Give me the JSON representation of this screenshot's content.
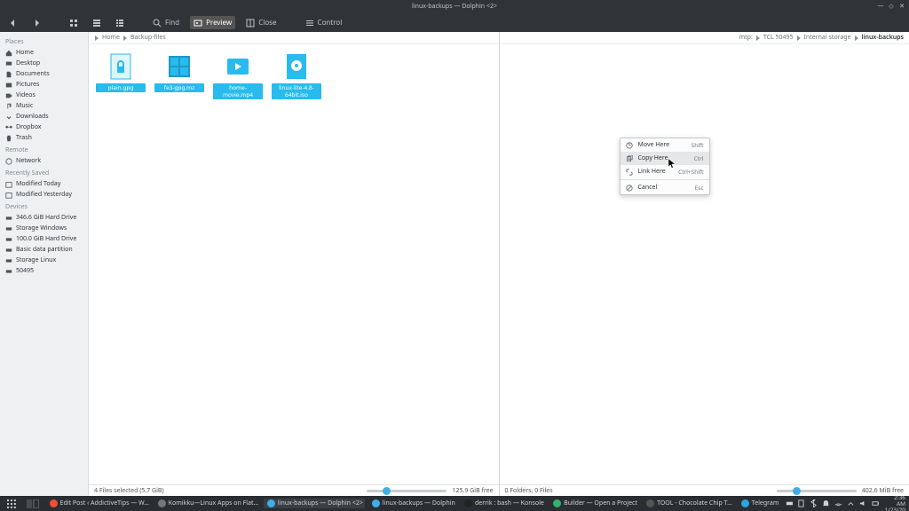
{
  "window": {
    "title": "linux-backups — Dolphin <2>"
  },
  "toolbar": {
    "back": "",
    "fwd": "",
    "icons_view": "",
    "compact_view": "",
    "details_view": "",
    "find": "Find",
    "preview": "Preview",
    "close": "Close",
    "control": "Control"
  },
  "sidebar": {
    "places_h": "Places",
    "places": [
      {
        "label": "Home"
      },
      {
        "label": "Desktop"
      },
      {
        "label": "Documents"
      },
      {
        "label": "Pictures"
      },
      {
        "label": "Videos"
      },
      {
        "label": "Music"
      },
      {
        "label": "Downloads"
      },
      {
        "label": "Dropbox"
      },
      {
        "label": "Trash"
      }
    ],
    "remote_h": "Remote",
    "remote": [
      {
        "label": "Network"
      }
    ],
    "recent_h": "Recently Saved",
    "recent": [
      {
        "label": "Modified Today"
      },
      {
        "label": "Modified Yesterday"
      }
    ],
    "devices_h": "Devices",
    "devices": [
      {
        "label": "346.6 GiB Hard Drive"
      },
      {
        "label": "Storage Windows"
      },
      {
        "label": "100.0 GiB Hard Drive"
      },
      {
        "label": "Basic data partition"
      },
      {
        "label": "Storage Linux"
      },
      {
        "label": "50495"
      }
    ]
  },
  "left_pane": {
    "crumbs": [
      "Home",
      "Backup-files"
    ],
    "files": [
      {
        "label": "plain.gpg"
      },
      {
        "label": "fe3-gpg.mz"
      },
      {
        "label": "home-movie.mp4"
      },
      {
        "label": "linux-lite-4.8-64bit.iso"
      }
    ],
    "status_left": "4 Files selected (5.7 GiB)",
    "status_right": "125.9 GiB free"
  },
  "right_pane": {
    "crumbs_prefix": "mtp:",
    "crumbs": [
      "TCL 50495",
      "Internal storage",
      "linux-backups"
    ],
    "status_left": "0 Folders, 0 Files",
    "status_right": "402.6 MiB free"
  },
  "context_menu": {
    "items": [
      {
        "label": "Move Here",
        "shortcut": "Shift"
      },
      {
        "label": "Copy Here",
        "shortcut": "Ctrl"
      },
      {
        "label": "Link Here",
        "shortcut": "Ctrl+Shift"
      },
      {
        "label": "Cancel",
        "shortcut": "Esc"
      }
    ]
  },
  "taskbar": {
    "tasks": [
      {
        "label": "Edit Post ‹ AddictiveTips — W…"
      },
      {
        "label": "Komikku—Linux Apps on Flat…"
      },
      {
        "label": "linux-backups — Dolphin <2>"
      },
      {
        "label": "linux-backups — Dolphin"
      },
      {
        "label": "derrik : bash — Konsole"
      },
      {
        "label": "Builder — Open a Project"
      },
      {
        "label": "TOOL - Chocolate Chip T…"
      },
      {
        "label": "Telegram"
      }
    ],
    "time": "2:36 AM",
    "date": "1/23/20"
  }
}
